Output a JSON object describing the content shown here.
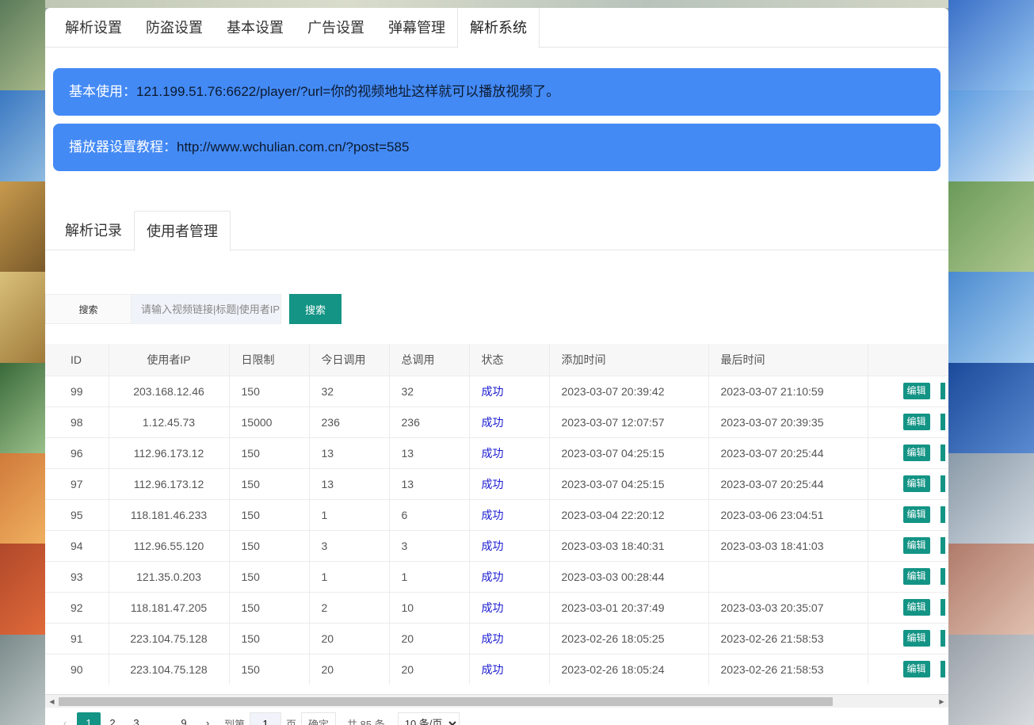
{
  "top_tabs": [
    {
      "label": "解析设置"
    },
    {
      "label": "防盗设置"
    },
    {
      "label": "基本设置"
    },
    {
      "label": "广告设置"
    },
    {
      "label": "弹幕管理"
    },
    {
      "label": "解析系统"
    }
  ],
  "notices": [
    {
      "label": "基本使用：",
      "value": "121.199.51.76:6622/player/?url=你的视频地址这样就可以播放视频了。"
    },
    {
      "label": "播放器设置教程：",
      "value": "http://www.wchulian.com.cn/?post=585"
    }
  ],
  "sub_tabs": [
    {
      "label": "解析记录"
    },
    {
      "label": "使用者管理"
    }
  ],
  "search": {
    "label": "搜索",
    "placeholder": "请输入视频链接|标题|使用者IP",
    "button": "搜索"
  },
  "table": {
    "headers": [
      "ID",
      "使用者IP",
      "日限制",
      "今日调用",
      "总调用",
      "状态",
      "添加时间",
      "最后时间",
      ""
    ],
    "edit_label": "编辑",
    "rows": [
      {
        "id": "99",
        "ip": "203.168.12.46",
        "limit": "150",
        "today": "32",
        "total": "32",
        "status": "成功",
        "added": "2023-03-07 20:39:42",
        "last": "2023-03-07 21:10:59"
      },
      {
        "id": "98",
        "ip": "1.12.45.73",
        "limit": "15000",
        "today": "236",
        "total": "236",
        "status": "成功",
        "added": "2023-03-07 12:07:57",
        "last": "2023-03-07 20:39:35"
      },
      {
        "id": "96",
        "ip": "112.96.173.12",
        "limit": "150",
        "today": "13",
        "total": "13",
        "status": "成功",
        "added": "2023-03-07 04:25:15",
        "last": "2023-03-07 20:25:44"
      },
      {
        "id": "97",
        "ip": "112.96.173.12",
        "limit": "150",
        "today": "13",
        "total": "13",
        "status": "成功",
        "added": "2023-03-07 04:25:15",
        "last": "2023-03-07 20:25:44"
      },
      {
        "id": "95",
        "ip": "118.181.46.233",
        "limit": "150",
        "today": "1",
        "total": "6",
        "status": "成功",
        "added": "2023-03-04 22:20:12",
        "last": "2023-03-06 23:04:51"
      },
      {
        "id": "94",
        "ip": "112.96.55.120",
        "limit": "150",
        "today": "3",
        "total": "3",
        "status": "成功",
        "added": "2023-03-03 18:40:31",
        "last": "2023-03-03 18:41:03"
      },
      {
        "id": "93",
        "ip": "121.35.0.203",
        "limit": "150",
        "today": "1",
        "total": "1",
        "status": "成功",
        "added": "2023-03-03 00:28:44",
        "last": ""
      },
      {
        "id": "92",
        "ip": "118.181.47.205",
        "limit": "150",
        "today": "2",
        "total": "10",
        "status": "成功",
        "added": "2023-03-01 20:37:49",
        "last": "2023-03-03 20:35:07"
      },
      {
        "id": "91",
        "ip": "223.104.75.128",
        "limit": "150",
        "today": "20",
        "total": "20",
        "status": "成功",
        "added": "2023-02-26 18:05:25",
        "last": "2023-02-26 21:58:53"
      },
      {
        "id": "90",
        "ip": "223.104.75.128",
        "limit": "150",
        "today": "20",
        "total": "20",
        "status": "成功",
        "added": "2023-02-26 18:05:24",
        "last": "2023-02-26 21:58:53"
      }
    ]
  },
  "pagination": {
    "prev": "‹",
    "pages": [
      "1",
      "2",
      "3"
    ],
    "dots": "…",
    "last_page": "9",
    "next": "›",
    "goto_label": "到第",
    "goto_value": "1",
    "page_suffix": "页",
    "confirm": "确定",
    "total": "共 85 条",
    "page_size": "10 条/页"
  },
  "colors": {
    "accent": "#139485",
    "notice_bg": "#448af5",
    "status_success": "#1a1ad0"
  }
}
